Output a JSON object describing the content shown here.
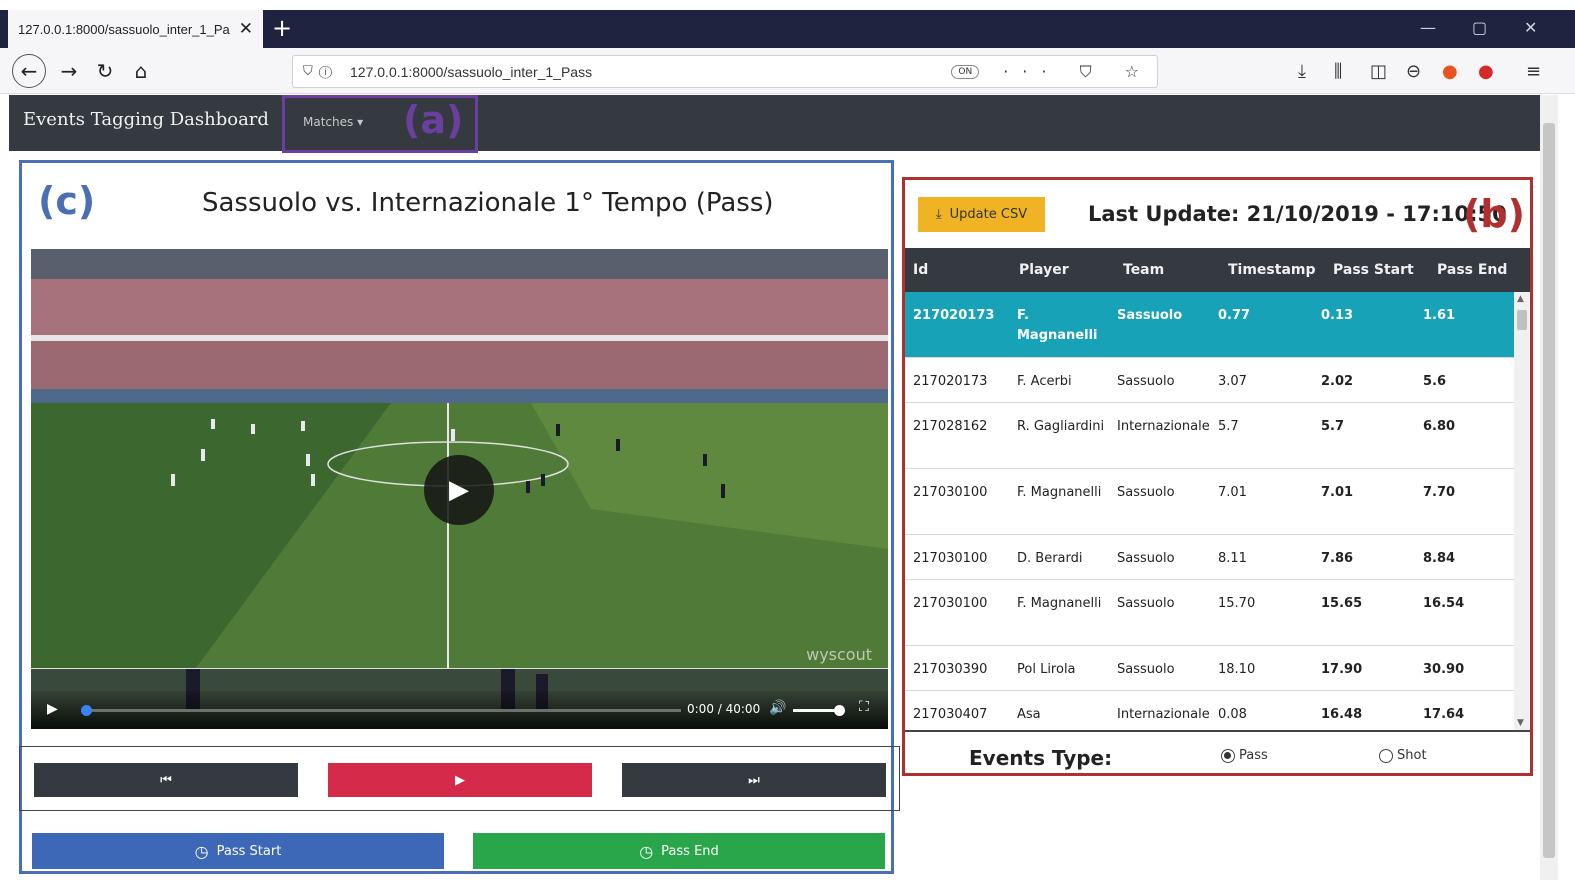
{
  "browser": {
    "tab_title": "127.0.0.1:8000/sassuolo_inter_1_Pa",
    "tab_close": "✕",
    "new_tab": "+",
    "url": "127.0.0.1:8000/sassuolo_inter_1_Pass",
    "reader_badge": "ON",
    "url_right_icons": "··· ⛉ ☆",
    "window_min": "—",
    "window_max": "▢",
    "window_close": "✕"
  },
  "app": {
    "brand": "Events Tagging Dashboard",
    "matches_label": "Matches",
    "matches_caret": "▾",
    "tag_a": "(a)",
    "tag_b": "(b)",
    "tag_c": "(c)"
  },
  "video": {
    "title": "Sassuolo vs. Internazionale 1° Tempo (Pass)",
    "time": "0:00 / 40:00",
    "watermark": "wyscout",
    "progress": 0
  },
  "controls": {
    "prev_icon": "⏮",
    "play_icon": "▶",
    "next_icon": "⏭",
    "pass_start": "Pass Start",
    "pass_end": "Pass End"
  },
  "table": {
    "update_button": "Update CSV",
    "last_update": "Last Update: 21/10/2019 - 17:10:50",
    "columns": [
      "Id",
      "Player",
      "Team",
      "Timestamp",
      "Pass Start",
      "Pass End"
    ],
    "rows": [
      {
        "id": "217020173",
        "player": "F. Magnanelli",
        "team": "Sassuolo",
        "timestamp": "0.77",
        "pass_start": "0.13",
        "pass_end": "1.61"
      },
      {
        "id": "217020173",
        "player": "F. Acerbi",
        "team": "Sassuolo",
        "timestamp": "3.07",
        "pass_start": "2.02",
        "pass_end": "5.6"
      },
      {
        "id": "217028162",
        "player": "R. Gagliardini",
        "team": "Internazionale",
        "timestamp": "5.7",
        "pass_start": "5.7",
        "pass_end": "6.80"
      },
      {
        "id": "217030100",
        "player": "F. Magnanelli",
        "team": "Sassuolo",
        "timestamp": "7.01",
        "pass_start": "7.01",
        "pass_end": "7.70"
      },
      {
        "id": "217030100",
        "player": "D. Berardi",
        "team": "Sassuolo",
        "timestamp": "8.11",
        "pass_start": "7.86",
        "pass_end": "8.84"
      },
      {
        "id": "217030100",
        "player": "F. Magnanelli",
        "team": "Sassuolo",
        "timestamp": "15.70",
        "pass_start": "15.65",
        "pass_end": "16.54"
      },
      {
        "id": "217030390",
        "player": "Pol Lirola",
        "team": "Sassuolo",
        "timestamp": "18.10",
        "pass_start": "17.90",
        "pass_end": "30.90"
      },
      {
        "id": "217030407",
        "player": "Asa",
        "team": "Internazionale",
        "timestamp": "0.08",
        "pass_start": "16.48",
        "pass_end": "17.64"
      }
    ],
    "selected_row": 0,
    "events_label": "Events Type:",
    "radio_pass": "Pass",
    "radio_shot": "Shot"
  }
}
